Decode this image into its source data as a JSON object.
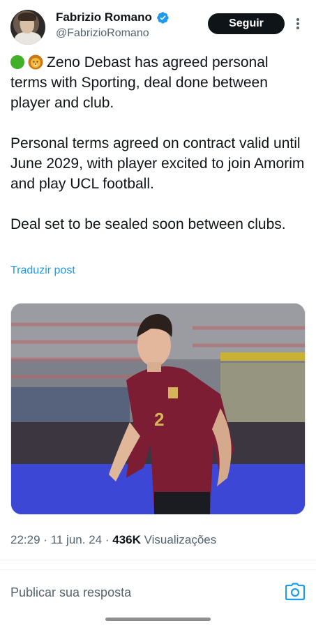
{
  "author": {
    "name": "Fabrizio Romano",
    "handle": "@FabrizioRomano",
    "verified": true
  },
  "follow_button": {
    "label": "Seguir"
  },
  "tweet": {
    "paragraphs": [
      "Zeno Debast has agreed personal terms with Sporting, deal done between player and club.",
      "Personal terms agreed on contract valid until June 2029, with player excited to join Amorim and play UCL football.",
      "Deal set to be sealed soon between clubs."
    ],
    "leading_emoji": [
      "green-circle-emoji",
      "lion-emoji"
    ]
  },
  "translate_link": "Traduzir post",
  "media": {
    "icon": "photo-football-player"
  },
  "meta": {
    "time": "22:29",
    "date": "11 jun. 24",
    "views_count": "436K",
    "views_label": "Visualizações",
    "separator": "·"
  },
  "reply": {
    "placeholder": "Publicar sua resposta"
  },
  "colors": {
    "accent": "#1d9bf0",
    "text": "#0f1419",
    "secondary": "#536471",
    "button_bg": "#0f1419"
  }
}
